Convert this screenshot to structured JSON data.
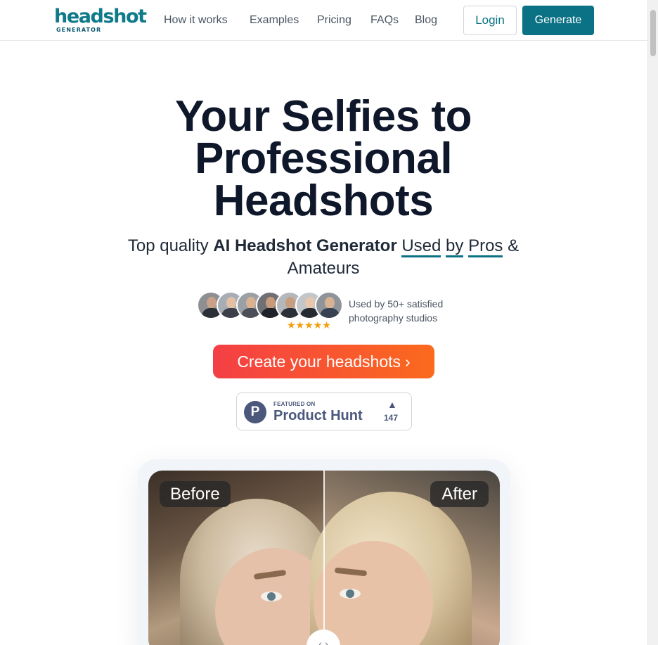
{
  "nav": {
    "logo_main": "headshot",
    "logo_sub": "GENERATOR",
    "links": [
      "How it works",
      "Examples",
      "Pricing",
      "FAQs",
      "Blog"
    ],
    "login_label": "Login",
    "generate_label": "Generate"
  },
  "hero": {
    "title_lines": [
      "Your Selfies to",
      "Professional",
      "Headshots"
    ],
    "subtitle_prefix": "Top quality ",
    "subtitle_bold": "AI Headshot Generator",
    "subtitle_used": "Used",
    "subtitle_by": "by",
    "subtitle_pros": "Pros",
    "subtitle_suffix": "&",
    "subtitle_line2": "Amateurs"
  },
  "social_proof": {
    "stars": "★★★★★",
    "text": "Used by 50+ satisfied photography studios",
    "avatar_count": 7
  },
  "cta": {
    "label": "Create your headshots",
    "chevron": "›"
  },
  "product_hunt": {
    "featured": "FEATURED ON",
    "name": "Product Hunt",
    "logo_letter": "P",
    "arrow": "▲",
    "upvotes": "147"
  },
  "before_after": {
    "before_label": "Before",
    "after_label": "After",
    "handle_glyph": "‹ ›",
    "split_fraction": 0.5
  },
  "colors": {
    "brand": "#0b7285",
    "cta_start": "#f43f45",
    "cta_end": "#fb6a1d",
    "stars": "#f59e0b",
    "product_hunt": "#4b587c"
  }
}
